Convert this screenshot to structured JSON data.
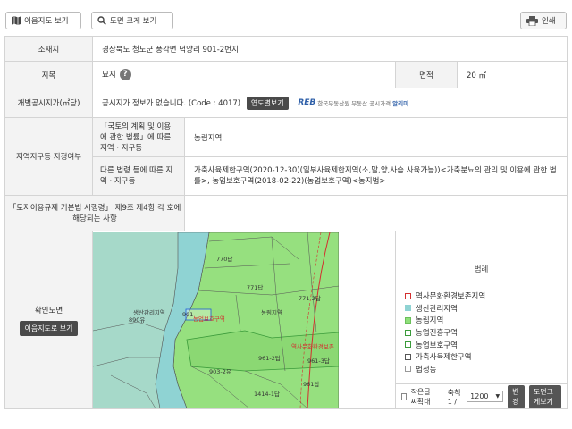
{
  "toolbar": {
    "map_button": "이음지도 보기",
    "big_button": "도면 크게 보기",
    "print_button": "인쇄"
  },
  "info": {
    "location_label": "소재지",
    "location_value": "경상북도 청도군 풍각면 덕양리 901-2번지",
    "land_type_label": "지목",
    "land_type_value": "묘지",
    "help_symbol": "?",
    "area_label": "면적",
    "area_value": "20 ㎡",
    "price_label": "개별공시지가(㎡당)",
    "price_value": "공시지가 정보가 없습니다. (Code : 4017)",
    "year_button": "연도별보기",
    "reb_logo": "REB",
    "reb_text": "한국부동산원",
    "reb_link_a": "부동산 공시가격",
    "reb_link_b": "알리미",
    "zone_label": "지역지구등 지정여부",
    "zone_law1_label": "「국토의 계획 및 이용에 관한 법률」에 따른 지역 · 지구등",
    "zone_law1_value": "농림지역",
    "zone_law2_label": "다른 법령 등에 따른 지역 · 지구등",
    "zone_law2_value": "가축사육제한구역(2020-12-30)(일부사육제한지역(소,말,양,사슴 사육가능))<가축분뇨의 관리 및 이용에 관한 법률>, 농업보호구역(2018-02-22)(농업보호구역)<농지법>",
    "decree_label": "「토지이용규제 기본법 시행령」 제9조 제4항 각 호에 해당되는 사항",
    "decree_value": "",
    "confirm_label": "확인도면",
    "confirm_button": "이음지도로 보기"
  },
  "map": {
    "labels": {
      "p770": "770답",
      "p771": "771답",
      "p771_2": "771-2답",
      "p901": "901",
      "p890": "890유",
      "forest": "농림지역",
      "prod": "생산관리지역",
      "agri": "농업보호구역",
      "p961_2": "961-2답",
      "p961_3": "961-3답",
      "p961": "961답",
      "p903_2": "903-2유",
      "p1414": "1414-1답",
      "heritage": "역사문화환경보존"
    }
  },
  "legend": {
    "title": "범례",
    "items": [
      {
        "label": "역사문화환경보존지역",
        "color": "#ffffff",
        "border": "#d32f2f"
      },
      {
        "label": "생산관리지역",
        "color": "#8fd3d3",
        "border": "#8fd3d3"
      },
      {
        "label": "농림지역",
        "color": "#8fe07a",
        "border": "#6bbf5a"
      },
      {
        "label": "농업진흥구역",
        "color": "#ffffff",
        "border": "#3a9a3a"
      },
      {
        "label": "농업보호구역",
        "color": "#ffffff",
        "border": "#3a9a3a"
      },
      {
        "label": "가축사육제한구역",
        "color": "#ffffff",
        "border": "#555555"
      },
      {
        "label": "법정동",
        "color": "#ffffff",
        "border": "#999999"
      }
    ],
    "small_text_label": "작은글씨확대",
    "scale_label": "축척 1 /",
    "scale_value": "1200",
    "scale_arrow": "▼",
    "change_button": "변경",
    "big_map_button": "도면크게보기"
  }
}
